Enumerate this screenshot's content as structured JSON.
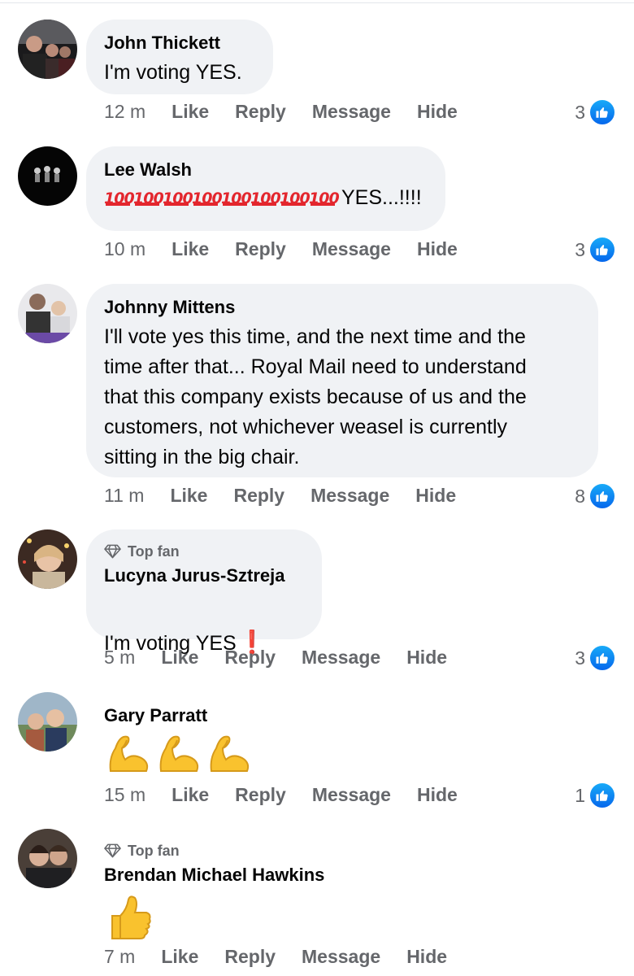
{
  "actions": {
    "like": "Like",
    "reply": "Reply",
    "message": "Message",
    "hide": "Hide"
  },
  "comments": [
    {
      "name": "John Thickett",
      "text": "I'm voting YES.",
      "time": "12 m",
      "reactions": "3"
    },
    {
      "name": "Lee Walsh",
      "emoji": "💯💯💯💯💯💯💯💯",
      "text": "YES...!!!!",
      "time": "10 m",
      "reactions": "3"
    },
    {
      "name": "Johnny Mittens",
      "text": "I'll vote yes this time, and the next time and the\ntime after that... Royal Mail need to understand\nthat this company exists because of us and the\ncustomers, not whichever weasel is currently\nsitting in the big chair.",
      "time": "11 m",
      "reactions": "8"
    },
    {
      "badge": "Top fan",
      "name": "Lucyna Jurus-Sztreja",
      "text": "I'm voting YES",
      "emoji_after": "❗",
      "time": "5 m",
      "reactions": "3"
    },
    {
      "name": "Gary Parratt",
      "emoji": "💪💪💪",
      "time": "15 m",
      "reactions": "1"
    },
    {
      "badge": "Top fan",
      "name": "Brendan Michael Hawkins",
      "emoji": "👍",
      "time": "7 m"
    }
  ],
  "colors": {
    "bubble": "#f0f2f5",
    "meta": "#65676b",
    "like_blue": "#1877f2",
    "hundred_red": "#e3262d"
  },
  "icons": {
    "like": "thumbs-up-icon",
    "top_fan": "diamond-icon"
  }
}
